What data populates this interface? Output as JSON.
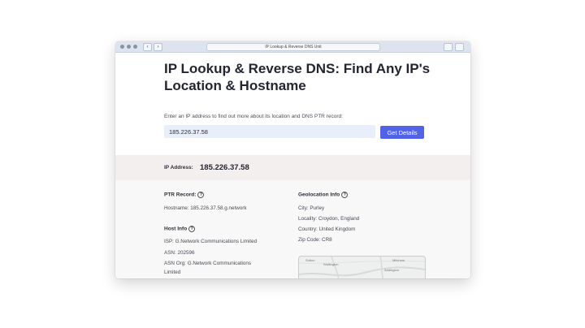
{
  "browser": {
    "url": "IP Lookup & Reverse DNS Unit",
    "back_icon": "chevron-left-icon",
    "forward_icon": "chevron-right-icon",
    "back_glyph": "‹",
    "forward_glyph": "›"
  },
  "hero": {
    "title": "IP Lookup & Reverse DNS: Find Any IP's Location & Hostname",
    "subtitle": "Enter an IP address to find out more about its location and DNS PTR record:",
    "input_value": "185.226.37.58",
    "button_label": "Get Details"
  },
  "result": {
    "ip_label": "IP Address:",
    "ip_value": "185.226.37.58"
  },
  "ptr": {
    "title": "PTR Record:",
    "hostname": "Hostname: 185.226.37.58.g.network"
  },
  "host": {
    "title": "Host Info",
    "isp": "ISP: G.Network Communications Limited",
    "asn": "ASN: 202596",
    "asn_org_1": "ASN Org: G.Network Communications",
    "asn_org_2": "Limited"
  },
  "geo": {
    "title": "Geolocation Info",
    "city": "City: Purley",
    "locality": "Locality: Croydon, England",
    "country": "Country: United Kingdom",
    "zip": "Zip Code: CR8"
  },
  "map": {
    "label_1": "Wallington",
    "label_2": "Addington",
    "label_3": "Mitcham",
    "label_4": "Sutton"
  },
  "info_glyph": "?",
  "colors": {
    "accent": "#5263e8",
    "band": "#f4efef",
    "input_bg": "#e9eefb"
  }
}
